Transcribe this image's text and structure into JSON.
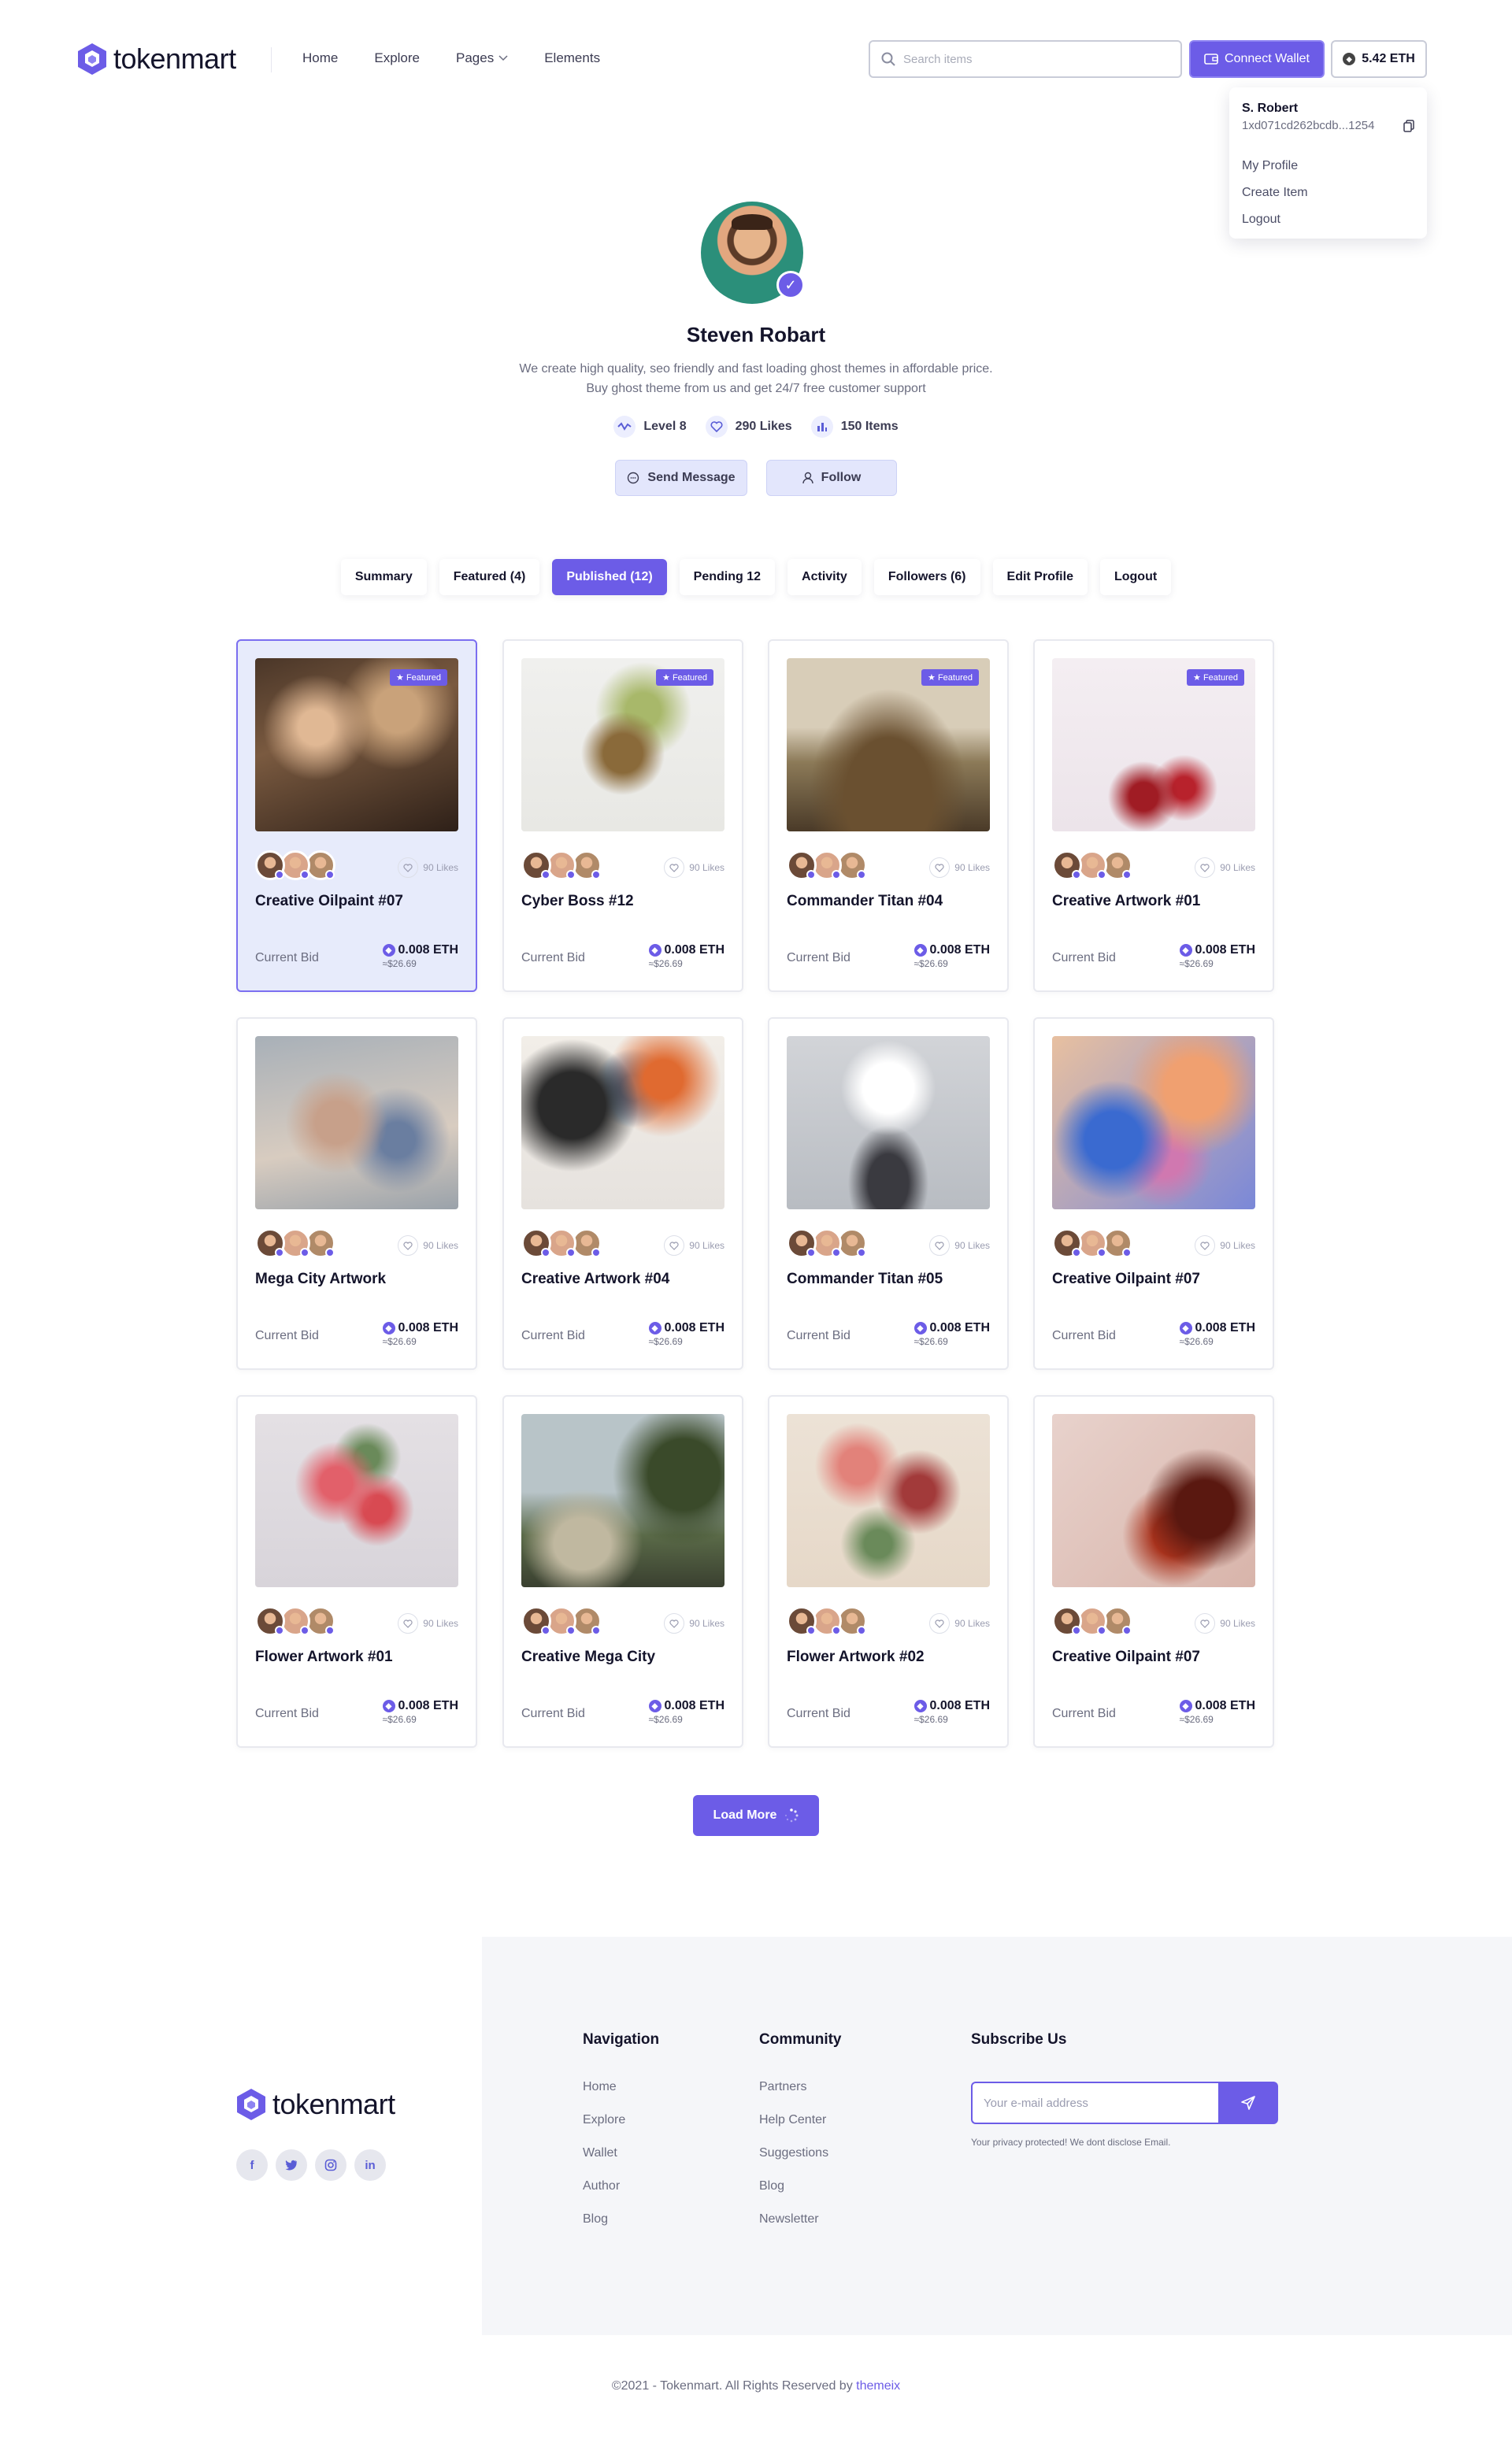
{
  "brand": {
    "name": "tokenmart"
  },
  "nav": {
    "home": "Home",
    "explore": "Explore",
    "pages": "Pages",
    "elements": "Elements"
  },
  "search": {
    "placeholder": "Search items"
  },
  "header": {
    "connect_wallet": "Connect Wallet",
    "balance": "5.42 ETH"
  },
  "dropdown": {
    "name": "S. Robert",
    "address": "1xd071cd262bcdb...1254",
    "items": [
      "My Profile",
      "Create Item",
      "Logout"
    ]
  },
  "profile": {
    "name": "Steven Robart",
    "bio_line1": "We create high quality, seo friendly and fast loading ghost themes in affordable price.",
    "bio_line2": "Buy ghost theme from us and get 24/7 free customer support",
    "stats": {
      "level": "Level 8",
      "likes": "290 Likes",
      "items": "150 Items"
    },
    "actions": {
      "message": "Send Message",
      "follow": "Follow"
    }
  },
  "tabs": [
    "Summary",
    "Featured (4)",
    "Published (12)",
    "Pending 12",
    "Activity",
    "Followers (6)",
    "Edit Profile",
    "Logout"
  ],
  "active_tab": "Published (12)",
  "cards": [
    {
      "title": "Creative Oilpaint #07",
      "featured": "★ Featured",
      "likes": "90 Likes",
      "bid_label": "Current Bid",
      "eth": "0.008 ETH",
      "usd": "≈$26.69"
    },
    {
      "title": "Cyber Boss #12",
      "featured": "★ Featured",
      "likes": "90 Likes",
      "bid_label": "Current Bid",
      "eth": "0.008 ETH",
      "usd": "≈$26.69"
    },
    {
      "title": "Commander Titan #04",
      "featured": "★ Featured",
      "likes": "90 Likes",
      "bid_label": "Current Bid",
      "eth": "0.008 ETH",
      "usd": "≈$26.69"
    },
    {
      "title": "Creative Artwork #01",
      "featured": "★ Featured",
      "likes": "90 Likes",
      "bid_label": "Current Bid",
      "eth": "0.008 ETH",
      "usd": "≈$26.69"
    },
    {
      "title": "Mega City Artwork",
      "featured": "",
      "likes": "90 Likes",
      "bid_label": "Current Bid",
      "eth": "0.008 ETH",
      "usd": "≈$26.69"
    },
    {
      "title": "Creative  Artwork #04",
      "featured": "",
      "likes": "90 Likes",
      "bid_label": "Current Bid",
      "eth": "0.008 ETH",
      "usd": "≈$26.69"
    },
    {
      "title": "Commander Titan #05",
      "featured": "",
      "likes": "90 Likes",
      "bid_label": "Current Bid",
      "eth": "0.008 ETH",
      "usd": "≈$26.69"
    },
    {
      "title": "Creative Oilpaint #07",
      "featured": "",
      "likes": "90 Likes",
      "bid_label": "Current Bid",
      "eth": "0.008 ETH",
      "usd": "≈$26.69"
    },
    {
      "title": "Flower Artwork #01",
      "featured": "",
      "likes": "90 Likes",
      "bid_label": "Current Bid",
      "eth": "0.008 ETH",
      "usd": "≈$26.69"
    },
    {
      "title": "Creative Mega City",
      "featured": "",
      "likes": "90 Likes",
      "bid_label": "Current Bid",
      "eth": "0.008 ETH",
      "usd": "≈$26.69"
    },
    {
      "title": "Flower Artwork #02",
      "featured": "",
      "likes": "90 Likes",
      "bid_label": "Current Bid",
      "eth": "0.008 ETH",
      "usd": "≈$26.69"
    },
    {
      "title": "Creative Oilpaint #07",
      "featured": "",
      "likes": "90 Likes",
      "bid_label": "Current Bid",
      "eth": "0.008 ETH",
      "usd": "≈$26.69"
    }
  ],
  "load_more": "Load More",
  "footer": {
    "navigation": {
      "title": "Navigation",
      "links": [
        "Home",
        "Explore",
        "Wallet",
        "Author",
        "Blog"
      ]
    },
    "community": {
      "title": "Community",
      "links": [
        "Partners",
        "Help Center",
        "Suggestions",
        "Blog",
        "Newsletter"
      ]
    },
    "subscribe": {
      "title": "Subscribe Us",
      "placeholder": "Your e-mail address",
      "note": "Your privacy protected! We dont disclose Email."
    },
    "social": [
      "f",
      "t",
      "ig",
      "in"
    ],
    "copyright": "©2021 - Tokenmart. All Rights Reserved by",
    "credit": "themeix"
  },
  "colors": {
    "accent": "#6c5ce7",
    "accent_light": "#e3e6fc",
    "text": "#14142b",
    "muted": "#6b6d80"
  }
}
